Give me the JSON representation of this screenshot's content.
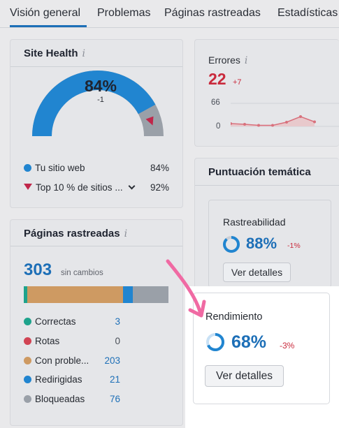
{
  "tabs": [
    {
      "label": "Visión general",
      "active": true
    },
    {
      "label": "Problemas"
    },
    {
      "label": "Páginas rastreadas"
    },
    {
      "label": "Estadísticas"
    }
  ],
  "site_health": {
    "title": "Site Health",
    "info": "i",
    "gauge_value": "84%",
    "gauge_delta": "-1",
    "gauge_fraction": 0.84,
    "colors": {
      "accent": "#2185d0",
      "rest": "#9aa0a8",
      "marker": "#c0264a"
    },
    "legend": [
      {
        "label": "Tu sitio web",
        "value": "84%"
      },
      {
        "label": "Top 10 % de sitios ...",
        "value": "92%"
      }
    ]
  },
  "errors": {
    "label": "Errores",
    "info": "i",
    "value": "22",
    "delta": "+7",
    "axis_max": "66",
    "axis_min": "0",
    "trend": [
      8,
      6,
      3,
      3,
      12,
      28,
      13
    ]
  },
  "pages": {
    "title": "Páginas rastreadas",
    "info": "i",
    "total": "303",
    "total_note": "sin cambios",
    "bar": [
      {
        "color": "#1ea38c",
        "value": 3
      },
      {
        "color": "#ce9a62",
        "value": 203
      },
      {
        "color": "#2185d0",
        "value": 21
      },
      {
        "color": "#9aa0a8",
        "value": 76
      }
    ],
    "rows": [
      {
        "label": "Correctas",
        "value": "3",
        "color": "#1ea38c"
      },
      {
        "label": "Rotas",
        "value": "0",
        "color": "#d14454"
      },
      {
        "label": "Con proble...",
        "value": "203",
        "color": "#ce9a62"
      },
      {
        "label": "Redirigidas",
        "value": "21",
        "color": "#2185d0"
      },
      {
        "label": "Bloqueadas",
        "value": "76",
        "color": "#9aa0a8"
      }
    ]
  },
  "thematic": {
    "title": "Puntuación temática",
    "crawlability": {
      "label": "Rastreabilidad",
      "value": "88%",
      "delta": "-1%",
      "fraction": 0.88,
      "button": "Ver detalles"
    },
    "performance": {
      "label": "Rendimiento",
      "value": "68%",
      "delta": "-3%",
      "fraction": 0.68,
      "button": "Ver detalles"
    }
  },
  "annotation": {
    "arrow_color": "#f06aa3"
  }
}
